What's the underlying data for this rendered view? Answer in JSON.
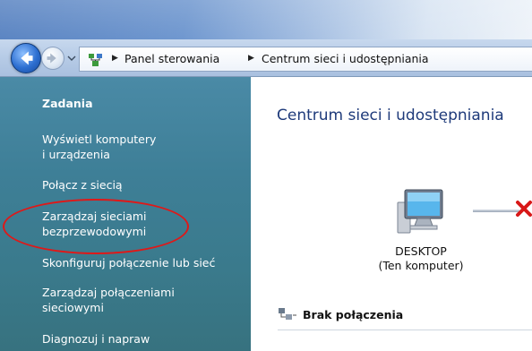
{
  "address_bar": {
    "crumbs": [
      "Panel sterowania",
      "Centrum sieci i udostępniania"
    ]
  },
  "task_pane": {
    "title": "Zadania",
    "links": [
      "Wyświetl komputery\ni urządzenia",
      "Połącz z siecią",
      "Zarządzaj sieciami\nbezprzewodowymi",
      "Skonfiguruj połączenie lub sieć",
      "Zarządzaj połączeniami\nsieciowymi",
      "Diagnozuj i napraw"
    ]
  },
  "main": {
    "heading": "Centrum sieci i udostępniania",
    "computer_name": "DESKTOP",
    "computer_subtitle": "(Ten komputer)",
    "connection_status": "Brak połączenia"
  },
  "icons": {
    "back": "back-arrow-icon",
    "forward": "forward-arrow-icon",
    "address": "network-folder-icon",
    "computer": "computer-monitor-icon",
    "error": "red-x-icon",
    "no_connection": "network-status-icon"
  },
  "colors": {
    "task_pane_bg": "#3e7f97",
    "heading": "#1e3a7a",
    "highlight": "#e01818"
  }
}
